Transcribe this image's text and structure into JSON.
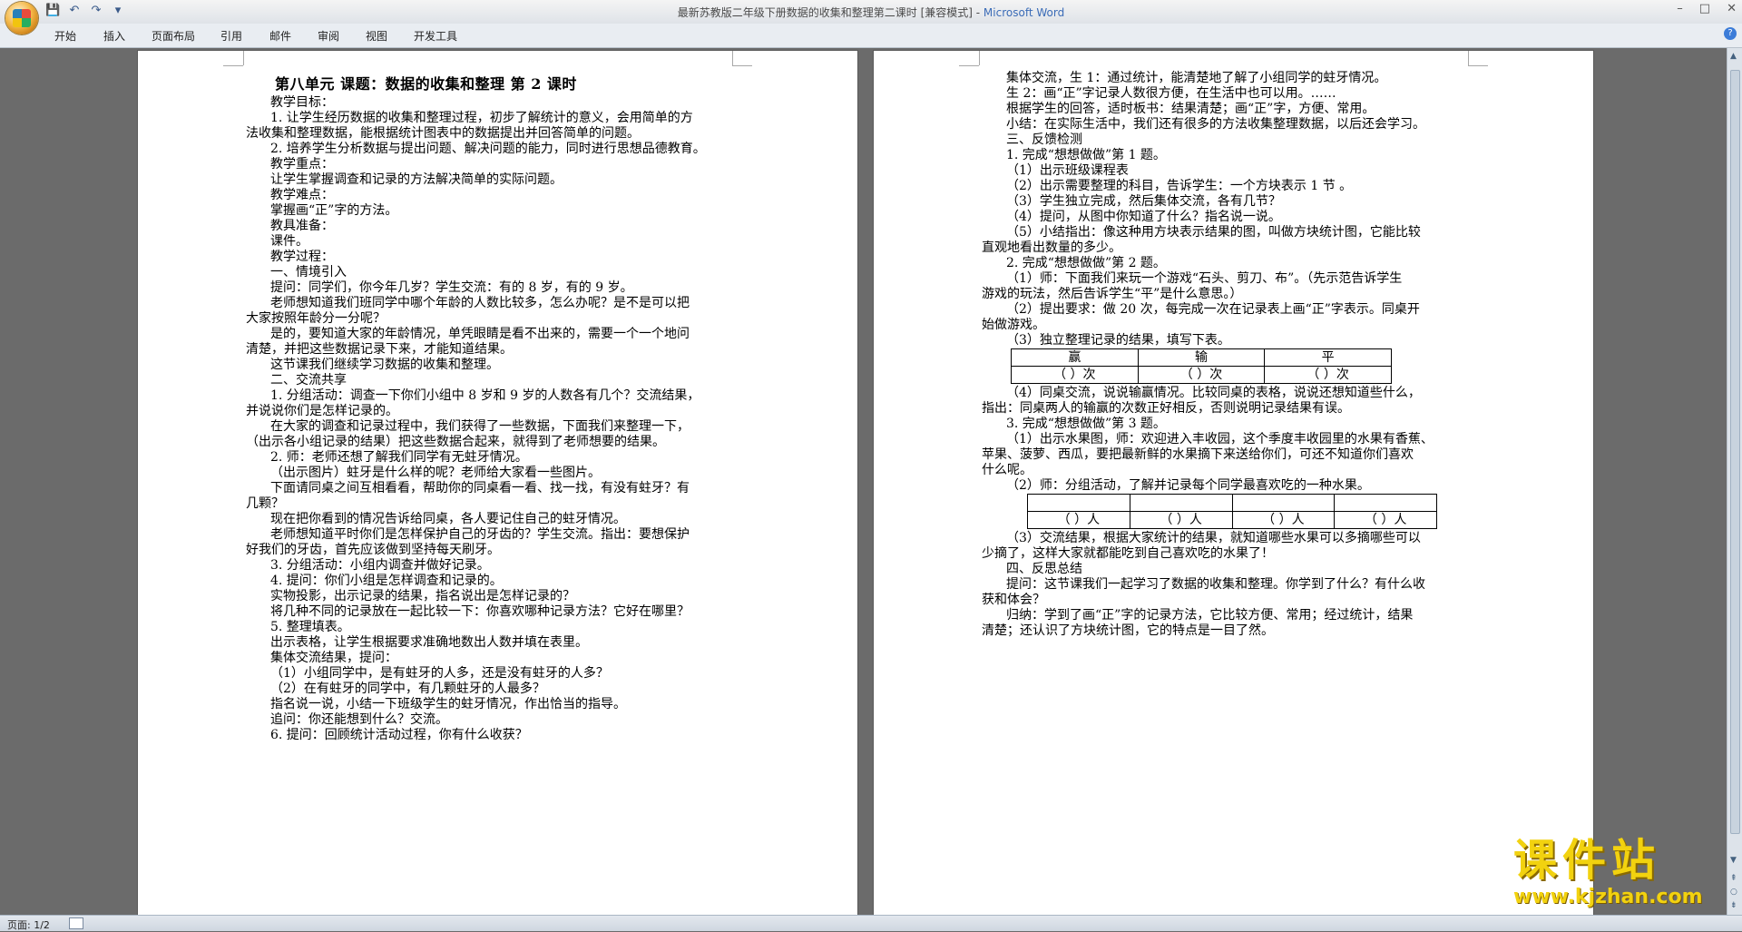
{
  "window": {
    "title": "最新苏教版二年级下册数据的收集和整理第二课时 [兼容模式] - ",
    "app_name": "Microsoft Word"
  },
  "ribbon": {
    "tabs": [
      "开始",
      "插入",
      "页面布局",
      "引用",
      "邮件",
      "审阅",
      "视图",
      "开发工具"
    ]
  },
  "status": {
    "pages": "页面: 1/2"
  },
  "watermark": {
    "title": "课件站",
    "url": "www.kjzhan.com"
  },
  "page1": {
    "title": "第八单元 课题：数据的收集和整理 第 2 课时",
    "lines": [
      "教学目标：",
      "1. 让学生经历数据的收集和整理过程，初步了解统计的意义，会用简单的方",
      "法收集和整理数据，能根据统计图表中的数据提出并回答简单的问题。",
      "2. 培养学生分析数据与提出问题、解决问题的能力，同时进行思想品德教育。",
      "教学重点：",
      "让学生掌握调查和记录的方法解决简单的实际问题。",
      "教学难点：",
      "掌握画“正”字的方法。",
      "教具准备：",
      "课件。",
      "教学过程：",
      "一、情境引入",
      "提问：同学们，你今年几岁？学生交流：有的 8 岁，有的 9 岁。",
      "老师想知道我们班同学中哪个年龄的人数比较多，怎么办呢？是不是可以把",
      "大家按照年龄分一分呢？",
      "是的，要知道大家的年龄情况，单凭眼睛是看不出来的，需要一个一个地问",
      "清楚，并把这些数据记录下来，才能知道结果。",
      "这节课我们继续学习数据的收集和整理。",
      "二、交流共享",
      "1. 分组活动：调查一下你们小组中 8 岁和 9 岁的人数各有几个？交流结果，",
      "并说说你们是怎样记录的。",
      "在大家的调查和记录过程中，我们获得了一些数据，下面我们来整理一下，",
      "（出示各小组记录的结果）把这些数据合起来，就得到了老师想要的结果。",
      "2. 师：老师还想了解我们同学有无蛀牙情况。",
      "（出示图片）蛀牙是什么样的呢？老师给大家看一些图片。",
      "下面请同桌之间互相看看，帮助你的同桌看一看、找一找，有没有蛀牙？有",
      "几颗？",
      "现在把你看到的情况告诉给同桌，各人要记住自己的蛀牙情况。",
      "老师想知道平时你们是怎样保护自己的牙齿的？学生交流。指出：要想保护",
      "好我们的牙齿，首先应该做到坚持每天刷牙。",
      "3. 分组活动：小组内调查并做好记录。",
      "4. 提问：你们小组是怎样调查和记录的。",
      "实物投影，出示记录的结果，指名说出是怎样记录的？",
      "将几种不同的记录放在一起比较一下：你喜欢哪种记录方法？它好在哪里？",
      "5. 整理填表。",
      "出示表格，让学生根据要求准确地数出人数并填在表里。",
      "集体交流结果，提问：",
      "（1）小组同学中，是有蛀牙的人多，还是没有蛀牙的人多？",
      "（2）在有蛀牙的同学中，有几颗蛀牙的人最多？",
      "指名说一说，小结一下班级学生的蛀牙情况，作出恰当的指导。",
      "追问：你还能想到什么？交流。",
      "6. 提问：回顾统计活动过程，你有什么收获？"
    ]
  },
  "page2": {
    "lines_a": [
      "集体交流，生 1：通过统计，能清楚地了解了小组同学的蛀牙情况。",
      "生 2：画“正”字记录人数很方便，在生活中也可以用。……",
      "根据学生的回答，适时板书：结果清楚；画“正”字，方便、常用。",
      "小结：在实际生活中，我们还有很多的方法收集整理数据，以后还会学习。",
      "三、反馈检测",
      "1. 完成“想想做做”第 1 题。",
      "（1）出示班级课程表",
      "（2）出示需要整理的科目，告诉学生：一个方块表示 1 节 。",
      "（3）学生独立完成，然后集体交流，各有几节？",
      "（4）提问，从图中你知道了什么？指名说一说。",
      "（5）小结指出：像这种用方块表示结果的图，叫做方块统计图，它能比较",
      "直观地看出数量的多少。",
      "2. 完成“想想做做”第 2 题。",
      "（1）师：下面我们来玩一个游戏“石头、剪刀、布”。（先示范告诉学生",
      "游戏的玩法，然后告诉学生“平”是什么意思。）",
      "（2）提出要求：做 20 次，每完成一次在记录表上画“正”字表示。同桌开",
      "始做游戏。",
      "（3）独立整理记录的结果，填写下表。"
    ],
    "table1": {
      "headers": [
        "赢",
        "输",
        "平"
      ],
      "cells": [
        "（ ）次",
        "（ ）次",
        "（ ）次"
      ]
    },
    "lines_b": [
      "（4）同桌交流，说说输赢情况。比较同桌的表格，说说还想知道些什么，",
      "指出：同桌两人的输赢的次数正好相反，否则说明记录结果有误。",
      "3. 完成“想想做做”第 3 题。",
      "（1）出示水果图，师：欢迎进入丰收园，这个季度丰收园里的水果有香蕉、",
      "苹果、菠萝、西瓜，要把最新鲜的水果摘下来送给你们，可还不知道你们喜欢",
      "什么呢。",
      "（2）师：分组活动，了解并记录每个同学最喜欢吃的一种水果。"
    ],
    "table2": {
      "cells": [
        "（ ）人",
        "（ ）人",
        "（ ）人",
        "（ ）人"
      ]
    },
    "lines_c": [
      "（3）交流结果，根据大家统计的结果，就知道哪些水果可以多摘哪些可以",
      "少摘了，这样大家就都能吃到自己喜欢吃的水果了！",
      "四、反思总结",
      "提问：这节课我们一起学习了数据的收集和整理。你学到了什么？有什么收",
      "获和体会？",
      "归纳：学到了画“正”字的记录方法，它比较方便、常用；经过统计，结果",
      "清楚；还认识了方块统计图，它的特点是一目了然。"
    ]
  }
}
